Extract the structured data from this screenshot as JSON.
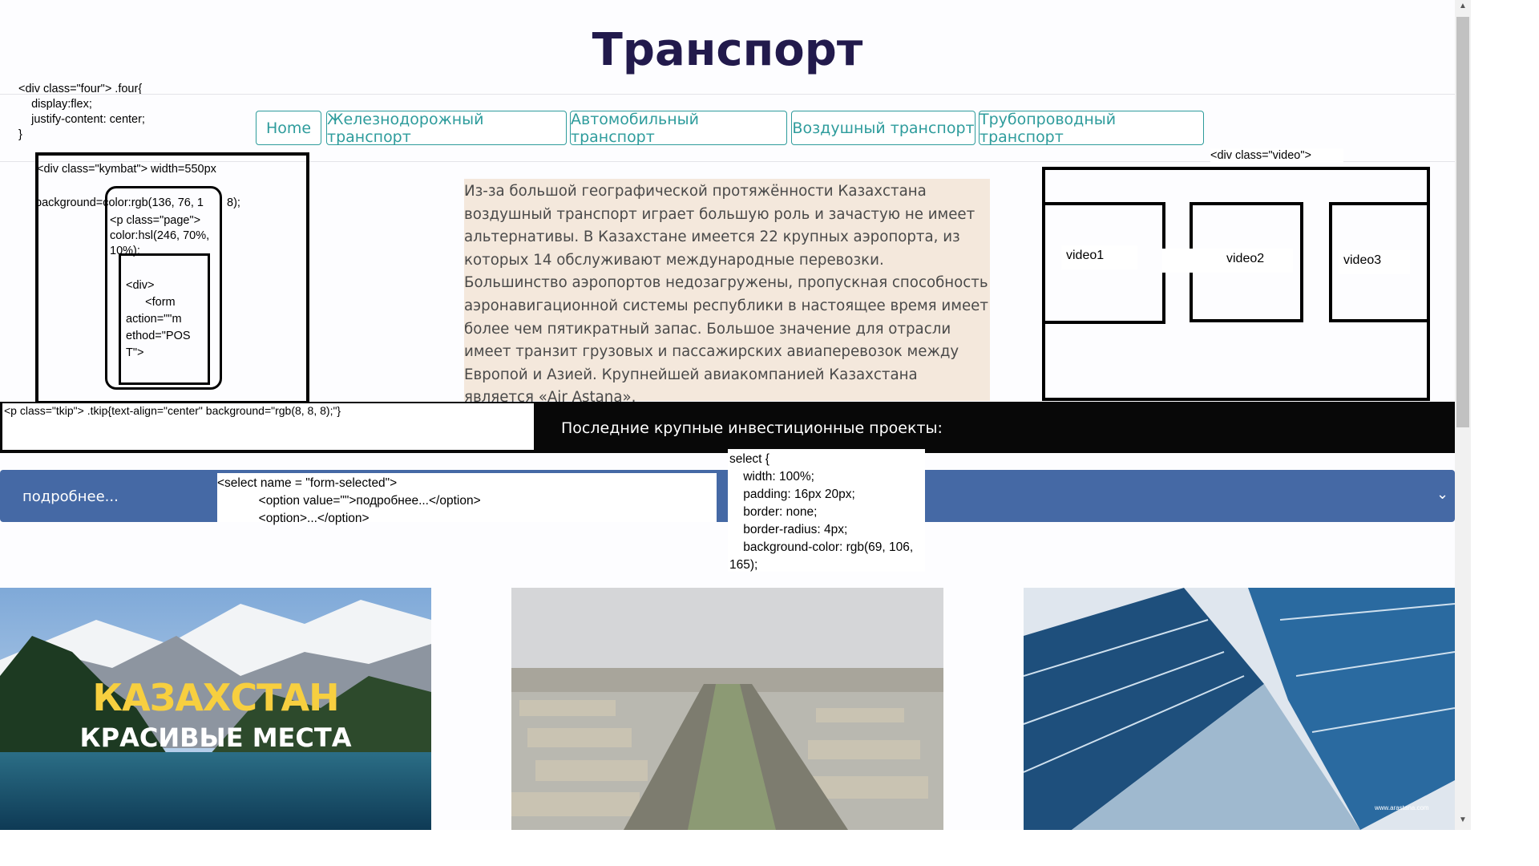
{
  "page": {
    "title": "Транспорт"
  },
  "nav": [
    {
      "label": "Home"
    },
    {
      "label": "Железнодорожный транспорт"
    },
    {
      "label": "Автомобильный транспорт"
    },
    {
      "label": "Воздушный транспорт"
    },
    {
      "label": "Трубопроводный транспорт"
    }
  ],
  "annotations": {
    "four": "<div class=\"four\"> .four{\n    display:flex;\n    justify-content: center;\n}",
    "kymbat": "<div class=\"kymbat\"> width=550px",
    "background": "background=color:rgb(136, 76, 1",
    "background_end": "8);",
    "page_p": "<p class=\"page\">\ncolor:hsl(246, 70%,\n10%);",
    "form": "<div>\n      <form\naction=\"\"m\nethod=\"POS\nT\">",
    "video": "<div class=\"video\">",
    "tkip": "<p class=\"tkip\"> .tkip{text-align=\"center\" background=\"rgb(8, 8, 8);\"}",
    "select_markup": "<select name = \"form-selected\">\n            <option value=\"\">подробнее...</option>\n            <option>...</option>",
    "select_css": "select {\n    width: 100%;\n    padding: 16px 20px;\n    border: none;\n    border-radius: 4px;\n    background-color: rgb(69, 106,\n165);"
  },
  "article": {
    "text": "Из-за большой географической протяжённости Казахстана воздушный транспорт играет большую роль и зачастую не имеет альтернативы. В Казахстане имеется 22 крупных аэропорта, из которых 14 обслуживают международные перевозки. Большинство аэропортов недозагружены, пропускная способность аэронавигационной системы республики в настоящее время имеет более чем пятикратный запас. Большое значение для отрасли имеет транзит грузовых и пассажирских авиаперевозок между Европой и Азией. Крупнейшей авиакомпанией Казахстана является «Air Astana»."
  },
  "videos": [
    {
      "label": "video1"
    },
    {
      "label": "video2"
    },
    {
      "label": "video3"
    }
  ],
  "investments": {
    "title": "Последние крупные инвестиционные проекты:"
  },
  "select": {
    "selected": "подробнее..."
  },
  "gallery": [
    {
      "title": "КАЗАХСТАН",
      "subtitle": "КРАСИВЫЕ МЕСТА"
    },
    {
      "title": ""
    },
    {
      "title": "",
      "credit": "www.arastana.com"
    }
  ],
  "colors": {
    "title": "#221a4c",
    "nav": "#2e9c9c",
    "article_bg": "#f4e8dc",
    "band": "#080808",
    "select_bg": "#4569a5"
  }
}
